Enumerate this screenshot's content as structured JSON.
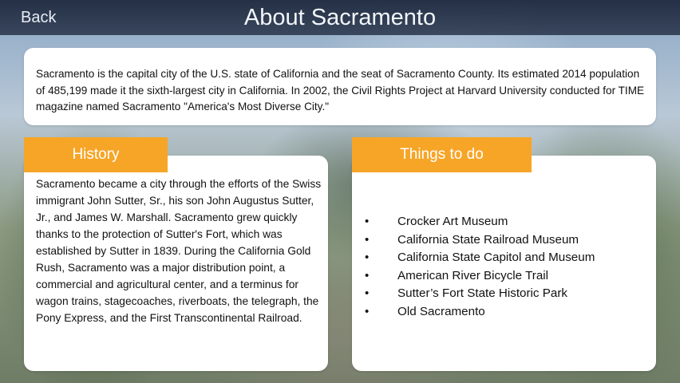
{
  "header": {
    "back_label": "Back",
    "title": "About Sacramento"
  },
  "intro": {
    "text": "Sacramento is the capital city of the U.S. state of California and the seat of Sacramento County. Its estimated 2014 population of 485,199 made it the sixth-largest city in California. In 2002, the Civil Rights Project at Harvard University conducted for TIME magazine named Sacramento \"America's Most Diverse City.\""
  },
  "history": {
    "tab_label": "History",
    "text": "Sacramento became a city through the efforts of the Swiss immigrant John Sutter, Sr., his son John Augustus Sutter, Jr., and James W. Marshall. Sacramento grew quickly thanks to the protection of Sutter's Fort, which was established by Sutter in 1839. During the California Gold Rush, Sacramento was a major distribution point, a commercial and agricultural center, and a terminus for wagon trains, stagecoaches, riverboats, the telegraph, the Pony Express, and the First Transcontinental Railroad."
  },
  "things_to_do": {
    "tab_label": "Things to do",
    "items": [
      "Crocker Art Museum",
      "California State Railroad Museum",
      "California State Capitol and Museum",
      "American River Bicycle Trail",
      "Sutter’s Fort State Historic Park",
      "Old Sacramento"
    ]
  },
  "colors": {
    "accent": "#f7a527",
    "header_bg": "#1c263a",
    "card_bg": "#ffffff"
  }
}
